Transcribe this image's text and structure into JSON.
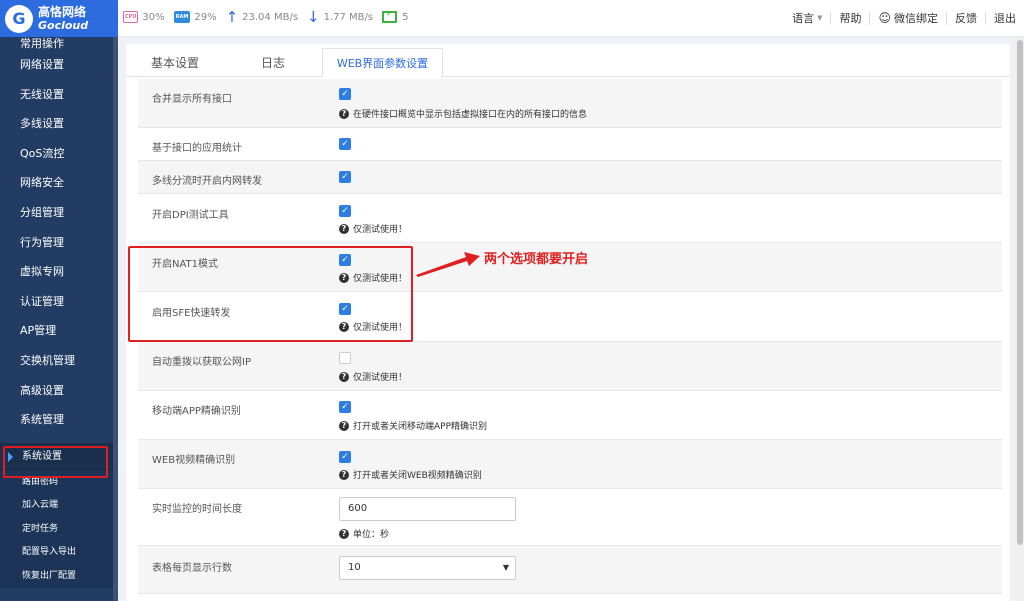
{
  "brand": {
    "name_cn": "高恪网络",
    "name_en": "Gocloud"
  },
  "stats": {
    "cpu_badge": "CPU",
    "cpu": "30%",
    "ram_badge": "RAM",
    "ram": "29%",
    "upload": "23.04 MB/s",
    "download": "1.77 MB/s",
    "online": "5"
  },
  "topnav": {
    "language": "语言",
    "help": "帮助",
    "wechat": "微信绑定",
    "feedback": "反馈",
    "logout": "退出"
  },
  "sidebar": {
    "items": [
      "常用操作",
      "网络设置",
      "无线设置",
      "多线设置",
      "QoS流控",
      "网络安全",
      "分组管理",
      "行为管理",
      "虚拟专网",
      "认证管理",
      "AP管理",
      "交换机管理",
      "高级设置",
      "系统管理"
    ],
    "active": "系统设置",
    "subitems": [
      "路由密码",
      "加入云端",
      "定时任务",
      "配置导入导出",
      "恢复出厂配置"
    ]
  },
  "tabs": [
    "基本设置",
    "日志",
    "WEB界面参数设置"
  ],
  "rows": [
    {
      "label": "合并显示所有接口",
      "checked": true,
      "help": "在硬件接口概览中显示包括虚拟接口在内的所有接口的信息"
    },
    {
      "label": "基于接口的应用统计",
      "checked": true,
      "help": ""
    },
    {
      "label": "多线分流时开启内网转发",
      "checked": true,
      "help": ""
    },
    {
      "label": "开启DPI测试工具",
      "checked": true,
      "help": "仅测试使用！"
    },
    {
      "label": "开启NAT1模式",
      "checked": true,
      "help": "仅测试使用！"
    },
    {
      "label": "启用SFE快速转发",
      "checked": true,
      "help": "仅测试使用！"
    },
    {
      "label": "自动重拨以获取公网IP",
      "checked": false,
      "help": "仅测试使用！"
    },
    {
      "label": "移动端APP精确识别",
      "checked": true,
      "help": "打开或者关闭移动端APP精确识别"
    },
    {
      "label": "WEB视频精确识别",
      "checked": true,
      "help": "打开或者关闭WEB视频精确识别"
    }
  ],
  "monitor": {
    "label": "实时监控的时间长度",
    "value": "600",
    "unit_help": "单位：秒"
  },
  "page_rows": {
    "label": "表格每页显示行数",
    "value": "10"
  },
  "annotation": "两个选项都要开启",
  "colors": {
    "accent": "#2d7de3",
    "sidebar": "#223c63",
    "highlight": "#e02020"
  }
}
